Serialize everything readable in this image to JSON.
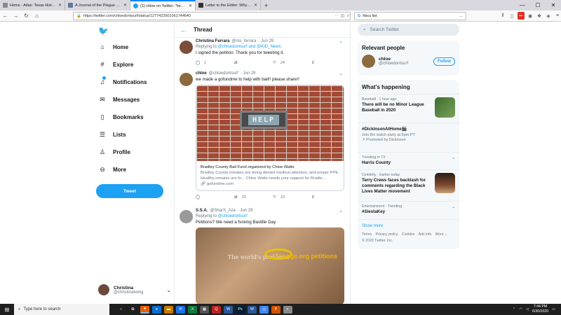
{
  "browser": {
    "tabs": [
      {
        "title": "Home - Atlas: Texas Historical ...",
        "icon": "texas-atlas-icon",
        "color": "#8a8a8a"
      },
      {
        "title": "A Journal of the Plague Year - Cour...",
        "icon": "document-icon",
        "color": "#5e7a9a"
      },
      {
        "title": "(1) chloe on Twitter: \"heartbrea...",
        "icon": "twitter-icon",
        "color": "#1da1f2"
      },
      {
        "title": "Letter to the Editor: Why Incarc...",
        "icon": "news-icon",
        "color": "#333333"
      }
    ],
    "url": "https://twitter.com/chloedontsurf/status/1277422601061744640",
    "search_value": "hbcu list",
    "new_tab": "+"
  },
  "twitter": {
    "nav": [
      {
        "label": "Home",
        "icon": "home-icon",
        "glyph": "⌂"
      },
      {
        "label": "Explore",
        "icon": "hashtag-icon",
        "glyph": "#"
      },
      {
        "label": "Notifications",
        "icon": "bell-icon",
        "glyph": "🔔"
      },
      {
        "label": "Messages",
        "icon": "envelope-icon",
        "glyph": "✉"
      },
      {
        "label": "Bookmarks",
        "icon": "bookmark-icon",
        "glyph": "🔖"
      },
      {
        "label": "Lists",
        "icon": "list-icon",
        "glyph": "☰"
      },
      {
        "label": "Profile",
        "icon": "person-icon",
        "glyph": "👤"
      },
      {
        "label": "More",
        "icon": "more-circle-icon",
        "glyph": "⋯"
      }
    ],
    "tweet_button": "Tweet",
    "account": {
      "name": "Christina",
      "handle": "@christinatwing"
    },
    "thread": {
      "title": "Thread",
      "tweets": [
        {
          "name": "Christina Ferrara",
          "handle": "@ms_ferrara",
          "time": "· Jun 29",
          "replying_prefix": "Replying to ",
          "replying_to": "@chloedontsurf and @KID_News",
          "text": "I signed the petition. Thank you for tweeting it.",
          "replies": "1",
          "retweets": "",
          "likes": "24"
        },
        {
          "name": "chloe",
          "handle": "@chloedontsurf",
          "time": "· Jun 29",
          "text": "we made a gofundme to help with bail!! please share!!",
          "image_text": "HELP",
          "card_title": "Bradley County Bail Fund organized by Chloe Watts",
          "card_desc": "Bradley County inmates are being denied medical attention, and proper PPE. Healthy inmates are fo... Chloe Watts needs your support for Bradle...",
          "card_domain": "gofundme.com",
          "replies": "",
          "retweets": "23",
          "likes": "19"
        },
        {
          "name": "S.S.A.",
          "handle": "@SharS_Aza",
          "time": "· Jun 29",
          "replying_prefix": "Replying to ",
          "replying_to": "@chloedontsurf",
          "text": "Petitions? We need a fvcking Bastille Day.",
          "image_text_1": "The world's problems",
          "image_text_2": "Change.org petitions"
        }
      ]
    },
    "right": {
      "search_placeholder": "Search Twitter",
      "relevant_title": "Relevant people",
      "relevant": {
        "name": "chloe",
        "handle": "@chloedontsurf",
        "button": "Follow"
      },
      "happening_title": "What’s happening",
      "trends": [
        {
          "context": "Baseball · 1 hour ago",
          "name": "There will be no Minor League Baseball in 2020",
          "extra": ""
        },
        {
          "context": "",
          "name": "#DickinsonAtHome🎬",
          "extra": "Join the watch party at 6pm PT",
          "promo": "Promoted by Dickinson"
        },
        {
          "context": "Trending in TX",
          "name": "Harris County",
          "extra": ""
        },
        {
          "context": "Celebrity · Earlier today",
          "name": "Terry Crews faces backlash for comments regarding the Black Lives Matter movement",
          "extra": ""
        },
        {
          "context": "Entertainment · Trending",
          "name": "#SiestaKey",
          "extra": ""
        }
      ],
      "show_more": "Show more",
      "footer_links": [
        "Terms",
        "Privacy policy",
        "Cookies",
        "Ads info",
        "More ⌄"
      ],
      "copyright": "© 2020 Twitter, Inc."
    }
  },
  "taskbar": {
    "search_placeholder": "Type here to search",
    "time": "7:44 PM",
    "date": "6/30/2020"
  },
  "colors": {
    "accent": "#1da1f2",
    "text": "#14171a",
    "muted": "#657786"
  }
}
